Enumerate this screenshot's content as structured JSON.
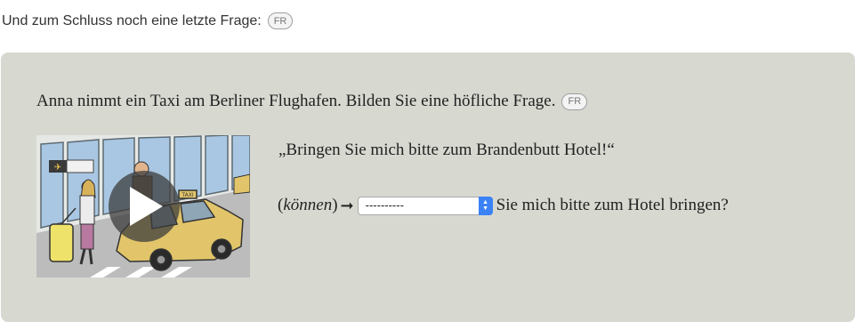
{
  "intro": {
    "text": "Und zum Schluss noch eine letzte Frage:",
    "badge": "FR"
  },
  "exercise": {
    "question": "Anna nimmt ein Taxi am Berliner Flughafen. Bilden Sie eine höfliche Frage.",
    "question_badge": "FR",
    "quote": "„Bringen Sie mich bitte zum Brandenbutt Hotel!“",
    "verb_open": "(",
    "verb": "können",
    "verb_close": ")",
    "arrow": "➞",
    "select": {
      "value": "----------"
    },
    "sentence_end": "Sie mich bitte zum Hotel bringen?"
  },
  "video": {
    "icon": "play-icon",
    "taxi_sign": "TAXI"
  },
  "colors": {
    "panel": "#d7d9d1",
    "select_button": "#3b82f6"
  }
}
